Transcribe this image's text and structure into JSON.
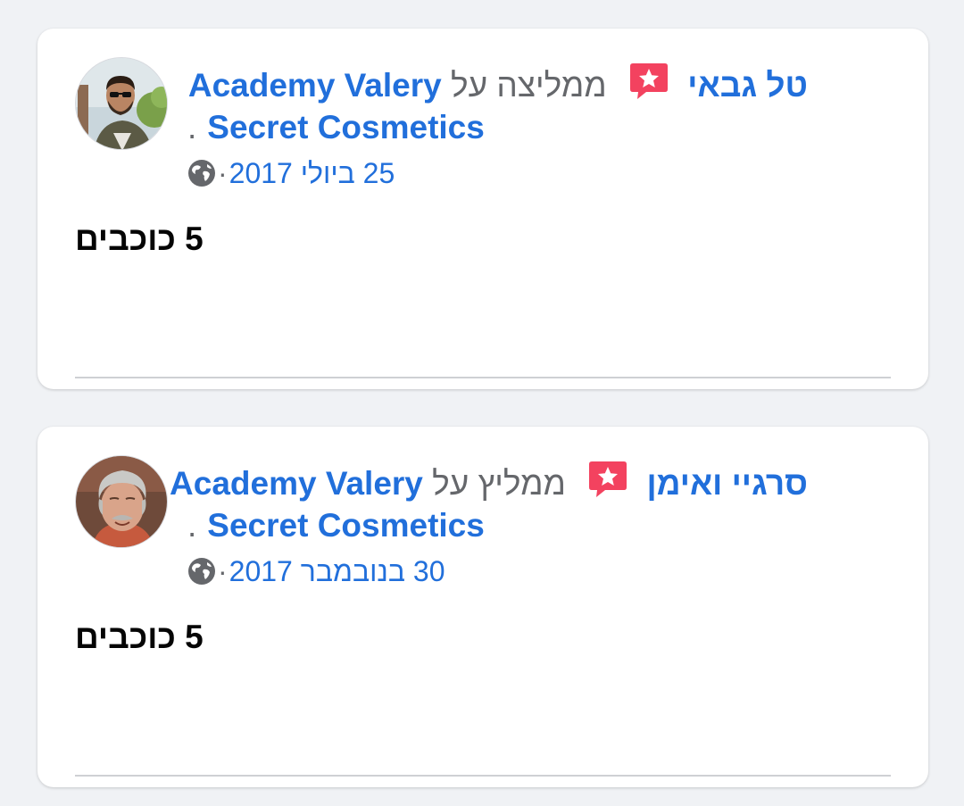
{
  "reviews": [
    {
      "author": "טל גבאי",
      "action": "ממליצה על",
      "page_name_1": "Academy Valery",
      "page_name_2": "Secret Cosmetics",
      "period": ".",
      "date": "25 ביולי 2017",
      "separator": "·",
      "rating": "5 כוכבים",
      "privacy_icon": "globe-icon",
      "recommend_icon": "recommend-star-icon"
    },
    {
      "author": "סרגיי ואימן",
      "action": "ממליץ על",
      "page_name_1": "Academy Valery",
      "page_name_2": "Secret Cosmetics",
      "period": ".",
      "date": "30 בנובמבר 2017",
      "separator": "·",
      "rating": "5 כוכבים",
      "privacy_icon": "globe-icon",
      "recommend_icon": "recommend-star-icon"
    }
  ],
  "colors": {
    "link": "#216fdb",
    "secondary_text": "#65676b",
    "primary_text": "#050505",
    "recommend_badge": "#f3425f",
    "background": "#f0f2f5"
  }
}
